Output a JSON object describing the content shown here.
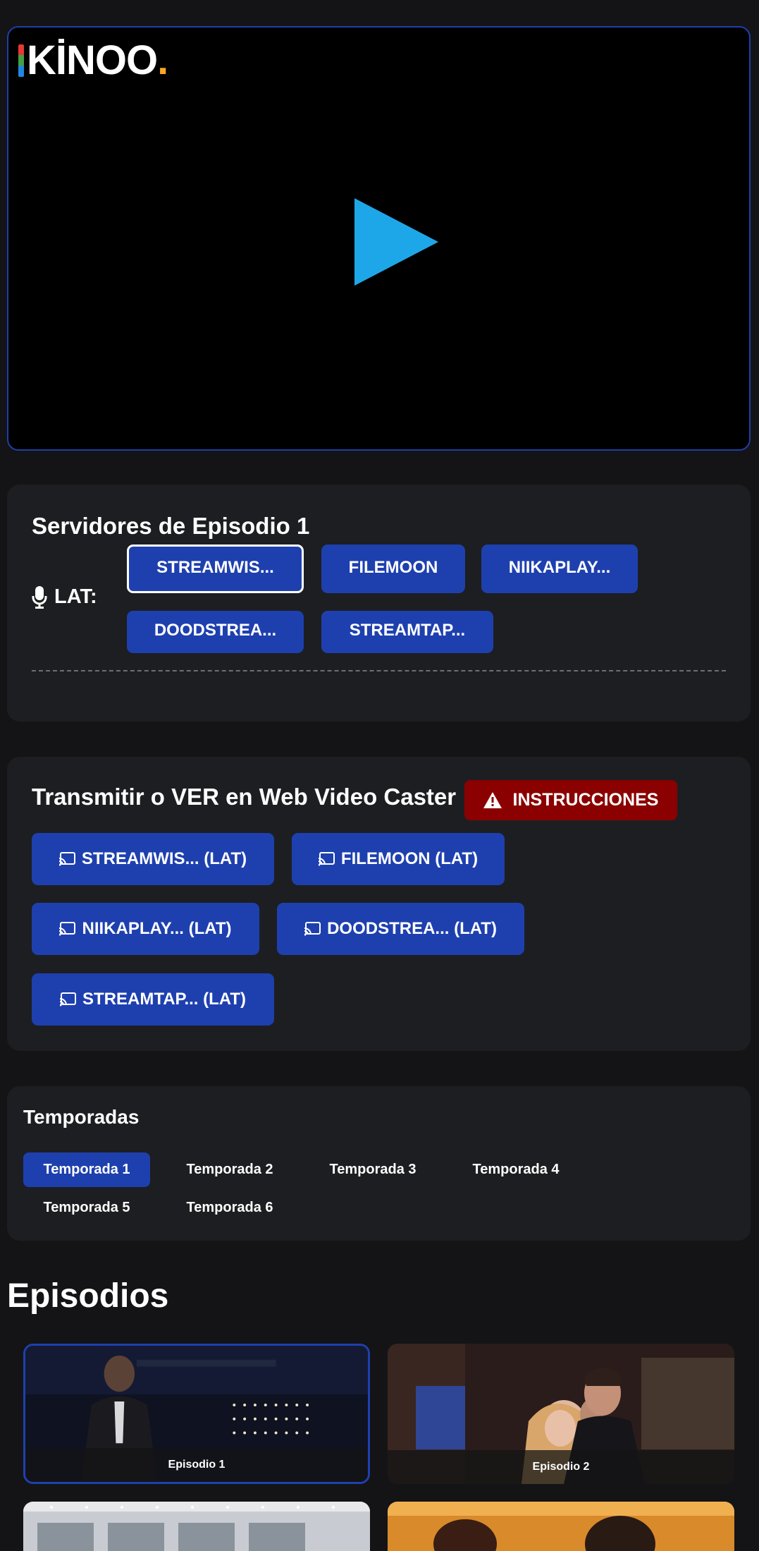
{
  "player": {
    "logo_text": "KİNOO",
    "logo_dot": "."
  },
  "servers": {
    "title": "Servidores de Episodio 1",
    "lang_label": "LAT:",
    "buttons": [
      "STREAMWIS...",
      "FILEMOON",
      "NIIKAPLAY...",
      "DOODSTREA...",
      "STREAMTAP..."
    ],
    "active_index": 0
  },
  "cast": {
    "title": "Transmitir o VER en Web Video Caster",
    "instructions_label": "INSTRUCCIONES",
    "buttons": [
      "STREAMWIS... (LAT)",
      "FILEMOON (LAT)",
      "NIIKAPLAY... (LAT)",
      "DOODSTREA... (LAT)",
      "STREAMTAP... (LAT)"
    ]
  },
  "seasons": {
    "title": "Temporadas",
    "items": [
      "Temporada 1",
      "Temporada 2",
      "Temporada 3",
      "Temporada 4",
      "Temporada 5",
      "Temporada 6"
    ],
    "active_index": 0
  },
  "episodes": {
    "title": "Episodios",
    "items": [
      "Episodio 1",
      "Episodio 2"
    ],
    "active_index": 0
  },
  "colors": {
    "accent": "#1e40af",
    "warning": "#8b0000",
    "play": "#1ea7e8",
    "background": "#141416",
    "card": "#1d1e21"
  }
}
